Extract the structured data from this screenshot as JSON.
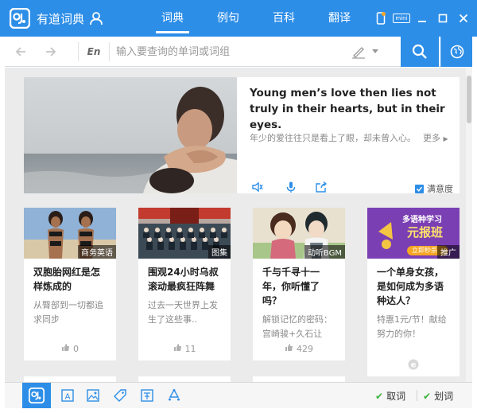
{
  "app": {
    "title": "有道词典"
  },
  "tabs": [
    {
      "label": "词典",
      "active": true
    },
    {
      "label": "例句",
      "active": false
    },
    {
      "label": "百科",
      "active": false
    },
    {
      "label": "翻译",
      "active": false
    }
  ],
  "window": {
    "mini_label": "mini"
  },
  "search": {
    "lang": "En",
    "placeholder": "输入要查询的单词或词组"
  },
  "feature": {
    "sentence_en": "Young men’s love then lies not truly in their hearts, but in their eyes.",
    "sentence_cn": "年少的爱往往只是看上了眼，却未曾入心。",
    "more": "更多",
    "satisfaction": "满意度"
  },
  "cards": [
    {
      "tag": "商务英语",
      "title": "双胞胎网红是怎样炼成的",
      "desc": "从臀部到一切都追求同步",
      "likes": "0"
    },
    {
      "tag": "图集",
      "title": "围观24小时乌叔滚动最疯狂阵舞",
      "desc": "过去一天世界上发生了这些事..",
      "likes": "11"
    },
    {
      "tag": "动听BGM",
      "title": "千与千寻十一年，你听懂了吗？",
      "desc": "解锁记忆的密码：宫崎骏+久石让",
      "likes": "429"
    },
    {
      "tag": "推广",
      "title": "一个单身女孩，是如何成为多语种达人？",
      "desc": "特惠1元/节！献给努力的你！",
      "likes": ""
    }
  ],
  "promo": {
    "line1": "多语种学习",
    "line2": "元报班",
    "button": "立即秒杀"
  },
  "bottom": {
    "quci": "取词",
    "huaci": "划词"
  },
  "colors": {
    "accent": "#2d8ee8",
    "check": "#3bb33b"
  }
}
